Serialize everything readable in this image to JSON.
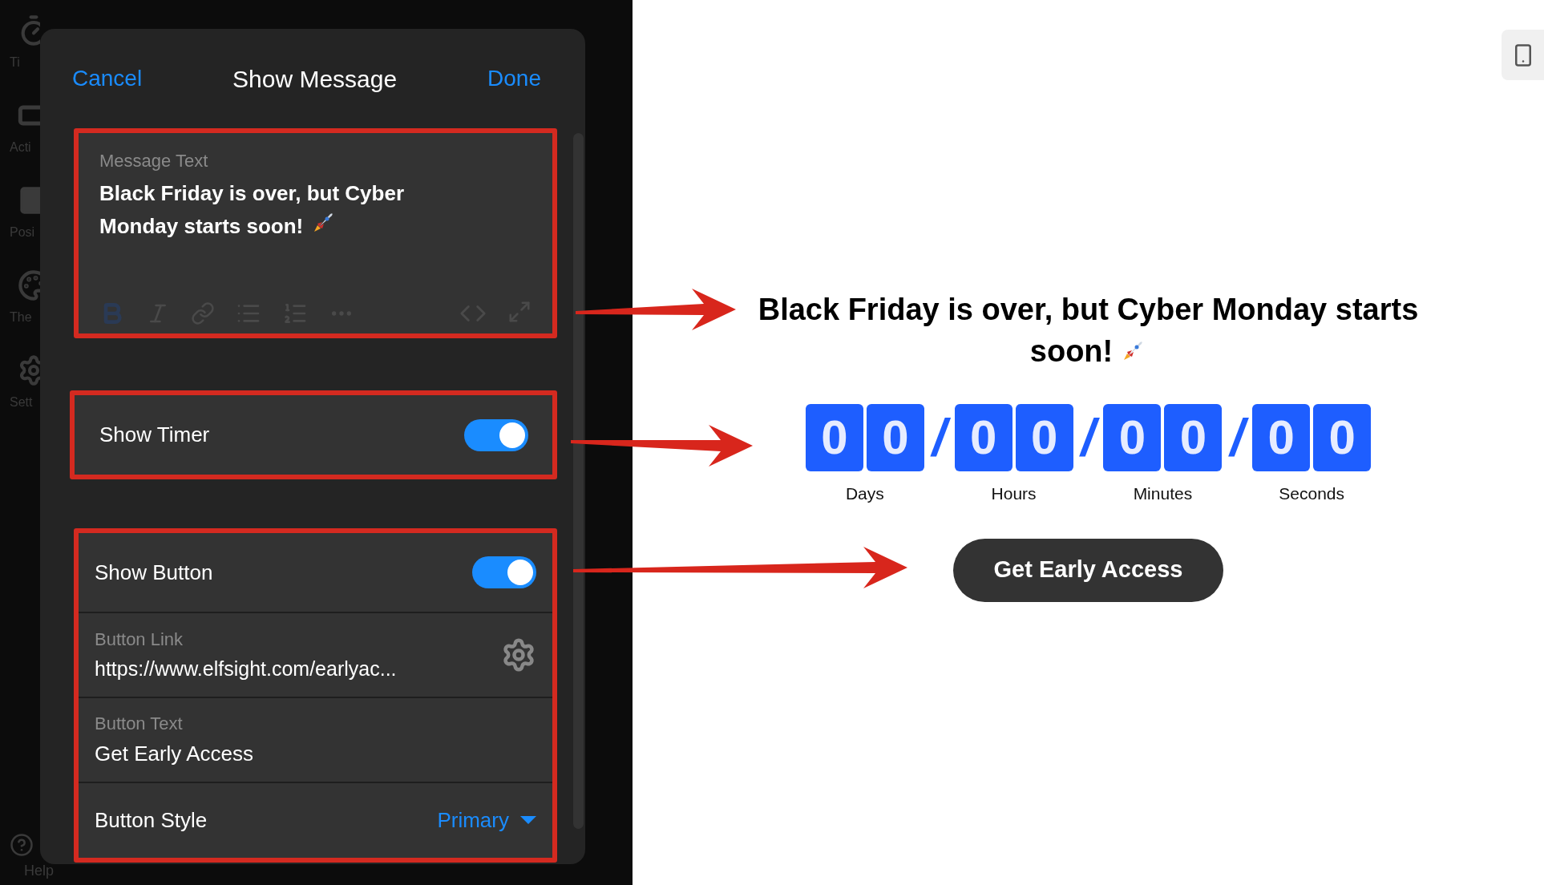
{
  "sidebar": {
    "items": [
      {
        "label": "Ti",
        "kind": "timer"
      },
      {
        "label": "Acti",
        "kind": "action"
      },
      {
        "label": "Posi",
        "kind": "position"
      },
      {
        "label": "The",
        "kind": "theme"
      },
      {
        "label": "Sett",
        "kind": "settings"
      }
    ],
    "help": {
      "label": "Help"
    }
  },
  "dialog": {
    "cancel": "Cancel",
    "title": "Show Message",
    "done": "Done",
    "message_field": {
      "label": "Message Text",
      "value": "Black Friday is over, but Cyber Monday starts soon!"
    },
    "show_timer": {
      "label": "Show Timer",
      "on": true
    },
    "show_button": {
      "label": "Show Button",
      "on": true
    },
    "button_link": {
      "label": "Button Link",
      "value": "https://www.elfsight.com/earlyac..."
    },
    "button_text": {
      "label": "Button Text",
      "value": "Get Early Access"
    },
    "button_style": {
      "label": "Button Style",
      "value": "Primary"
    }
  },
  "preview": {
    "message": "Black Friday is over, but Cyber Monday starts soon!",
    "timer": {
      "units": [
        {
          "digits": [
            "0",
            "0"
          ],
          "label": "Days"
        },
        {
          "digits": [
            "0",
            "0"
          ],
          "label": "Hours"
        },
        {
          "digits": [
            "0",
            "0"
          ],
          "label": "Minutes"
        },
        {
          "digits": [
            "0",
            "0"
          ],
          "label": "Seconds"
        }
      ],
      "separators": [
        "/",
        "/",
        "/"
      ]
    },
    "button": "Get Early Access"
  }
}
